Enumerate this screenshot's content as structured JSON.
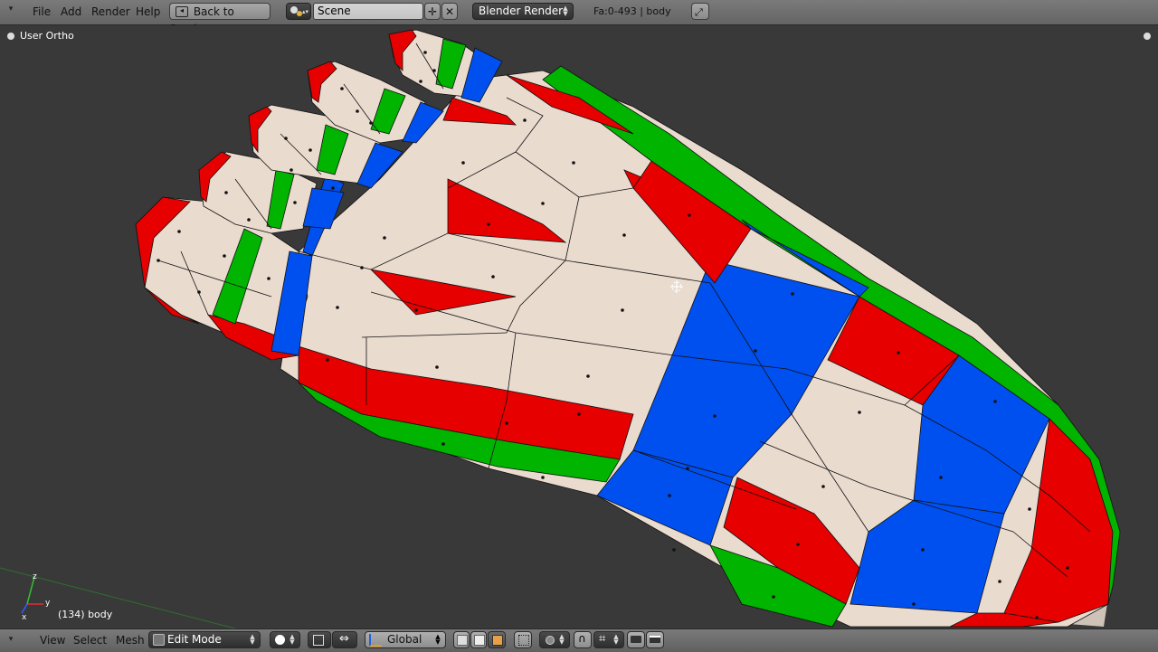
{
  "top_header": {
    "menus": [
      "File",
      "Add",
      "Render",
      "Help"
    ],
    "back_button": "Back to Previous",
    "scene_field": "Scene",
    "render_engine": "Blender Render",
    "stats": "Fa:0-493 | body"
  },
  "viewport": {
    "title": "User Ortho",
    "object_info": "(134) body",
    "axis_labels": {
      "x": "x",
      "y": "y",
      "z": "z"
    }
  },
  "bottom_header": {
    "menus": [
      "View",
      "Select",
      "Mesh"
    ],
    "mode": "Edit Mode",
    "orientation": "Global"
  },
  "colors": {
    "header_bg": "#6e6e6e",
    "viewport_bg": "#393939",
    "mesh_skin": "#eadbcf",
    "seam_red": "#e60000",
    "seam_green": "#00b400",
    "seam_blue": "#0050f0"
  }
}
